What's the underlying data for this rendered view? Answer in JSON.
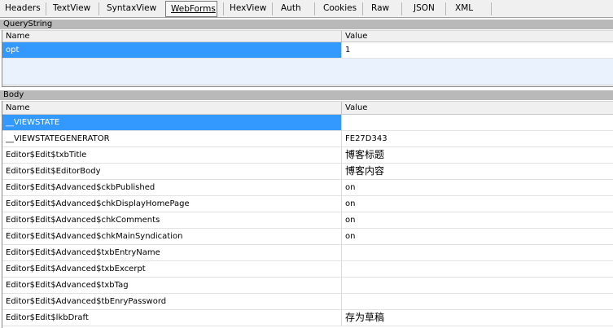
{
  "tabs": [
    {
      "label": "Headers"
    },
    {
      "label": "TextView"
    },
    {
      "label": "SyntaxView"
    },
    {
      "label": "WebForms",
      "active": true
    },
    {
      "label": "HexView"
    },
    {
      "label": "Auth"
    },
    {
      "label": "Cookies"
    },
    {
      "label": "Raw"
    },
    {
      "label": "JSON"
    },
    {
      "label": "XML"
    }
  ],
  "querystring": {
    "title": "QueryString",
    "col_name": "Name",
    "col_value": "Value",
    "rows": [
      {
        "name": "opt",
        "value": "1"
      }
    ]
  },
  "body": {
    "title": "Body",
    "col_name": "Name",
    "col_value": "Value",
    "rows": [
      {
        "name": "__VIEWSTATE",
        "value": ""
      },
      {
        "name": "__VIEWSTATEGENERATOR",
        "value": "FE27D343"
      },
      {
        "name": "Editor$Edit$txbTitle",
        "value": "博客标题"
      },
      {
        "name": "Editor$Edit$EditorBody",
        "value": "博客内容"
      },
      {
        "name": "Editor$Edit$Advanced$ckbPublished",
        "value": "on"
      },
      {
        "name": "Editor$Edit$Advanced$chkDisplayHomePage",
        "value": "on"
      },
      {
        "name": "Editor$Edit$Advanced$chkComments",
        "value": "on"
      },
      {
        "name": "Editor$Edit$Advanced$chkMainSyndication",
        "value": "on"
      },
      {
        "name": "Editor$Edit$Advanced$txbEntryName",
        "value": ""
      },
      {
        "name": "Editor$Edit$Advanced$txbExcerpt",
        "value": ""
      },
      {
        "name": "Editor$Edit$Advanced$txbTag",
        "value": ""
      },
      {
        "name": "Editor$Edit$Advanced$tbEnryPassword",
        "value": ""
      },
      {
        "name": "Editor$Edit$lkbDraft",
        "value": "存为草稿"
      }
    ]
  },
  "colors": {
    "selection": "#3399ff",
    "section_header": "#b9b9b9",
    "tabbar": "#f0f0f0"
  }
}
